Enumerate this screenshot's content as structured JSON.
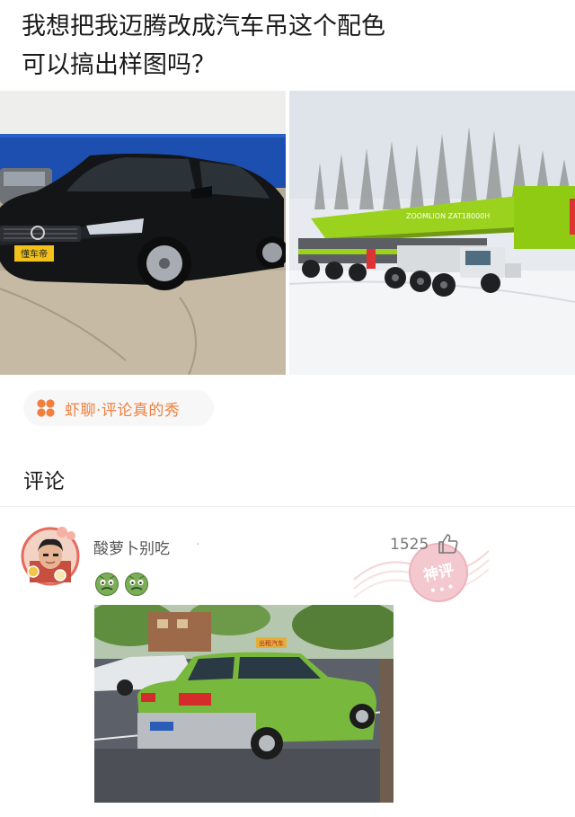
{
  "post": {
    "title_line1": "我想把我迈腾改成汽车吊这个配色",
    "title_line2": "可以搞出样图吗？",
    "left_photo": {
      "plate_text": "懂车帝"
    },
    "right_photo": {
      "boom_text": "ZOOMLION  ZAT18000H"
    }
  },
  "topic": {
    "label": "虾聊·评论真的秀",
    "icon": "four-dots-icon",
    "color": "#f07f3d"
  },
  "comments_section": {
    "title": "评论"
  },
  "comment": {
    "username": "酸萝卜别吃",
    "separator": "·",
    "like_count": "1525",
    "like_icon": "thumbs-up-icon",
    "stamp_text": "神评",
    "emojis": [
      "zombie-face-emoji",
      "zombie-face-emoji"
    ],
    "photo": {
      "sign_text": "出租汽车"
    }
  }
}
